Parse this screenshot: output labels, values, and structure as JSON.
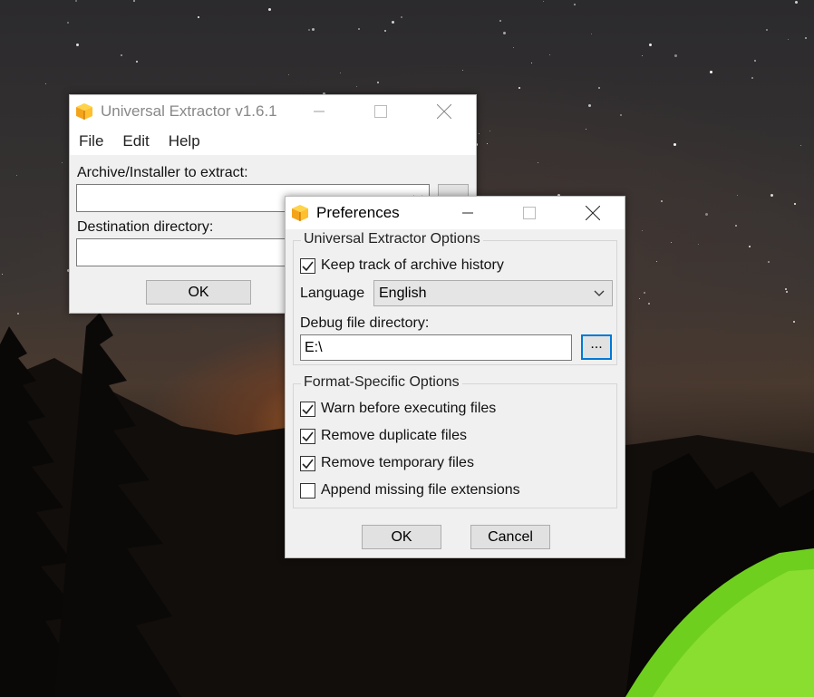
{
  "desktop": {
    "theme": "night sky wallpaper with tent"
  },
  "main_window": {
    "title": "Universal Extractor v1.6.1",
    "menu": [
      "File",
      "Edit",
      "Help"
    ],
    "archive_label": "Archive/Installer to extract:",
    "archive_value": "",
    "destination_label": "Destination directory:",
    "destination_value": "",
    "ok_label": "OK"
  },
  "preferences": {
    "title": "Preferences",
    "ue_options": {
      "group_title": "Universal Extractor Options",
      "keep_history_label": "Keep track of archive history",
      "keep_history_checked": true,
      "language_label": "Language",
      "language_value": "English",
      "debug_dir_label": "Debug file directory:",
      "debug_dir_value": "E:\\",
      "browse_label": "..."
    },
    "format_options": {
      "group_title": "Format-Specific Options",
      "items": [
        {
          "label": "Warn before executing files",
          "checked": true
        },
        {
          "label": "Remove duplicate files",
          "checked": true
        },
        {
          "label": "Remove temporary files",
          "checked": true
        },
        {
          "label": "Append missing file extensions",
          "checked": false
        }
      ]
    },
    "ok_label": "OK",
    "cancel_label": "Cancel"
  }
}
